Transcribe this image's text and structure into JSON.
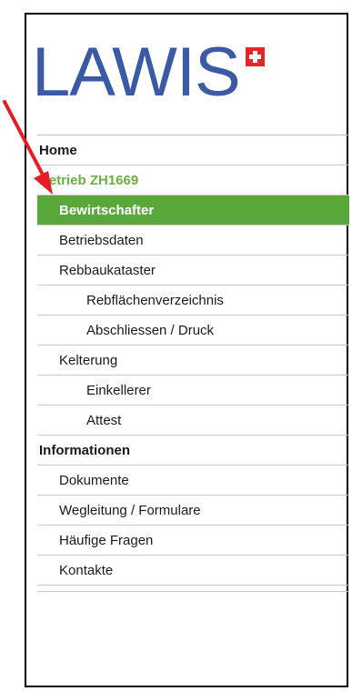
{
  "logo": {
    "text": "LAWIS",
    "flag_icon": "swiss-flag-icon",
    "flag_color": "#e8262a",
    "text_color": "#3b5aa6"
  },
  "nav": {
    "items": [
      {
        "label": "Home",
        "level": 0,
        "state": "normal"
      },
      {
        "label": "Betrieb ZH1669",
        "level": 0,
        "state": "group"
      },
      {
        "label": "Bewirtschafter",
        "level": 1,
        "state": "active"
      },
      {
        "label": "Betriebsdaten",
        "level": 1,
        "state": "normal"
      },
      {
        "label": "Rebbaukataster",
        "level": 1,
        "state": "normal"
      },
      {
        "label": "Rebflächenverzeichnis",
        "level": 2,
        "state": "normal"
      },
      {
        "label": "Abschliessen / Druck",
        "level": 2,
        "state": "normal"
      },
      {
        "label": "Kelterung",
        "level": 1,
        "state": "normal"
      },
      {
        "label": "Einkellerer",
        "level": 2,
        "state": "normal"
      },
      {
        "label": "Attest",
        "level": 2,
        "state": "normal"
      },
      {
        "label": "Informationen",
        "level": 0,
        "state": "normal"
      },
      {
        "label": "Dokumente",
        "level": 1,
        "state": "normal"
      },
      {
        "label": "Wegleitung / Formulare",
        "level": 1,
        "state": "normal"
      },
      {
        "label": "Häufige Fragen",
        "level": 1,
        "state": "normal"
      },
      {
        "label": "Kontakte",
        "level": 1,
        "state": "normal"
      }
    ]
  },
  "colors": {
    "active_bg": "#5aa83a",
    "group_text": "#6cae45",
    "arrow": "#e31e24"
  },
  "annotation": {
    "icon": "red-arrow-icon"
  }
}
